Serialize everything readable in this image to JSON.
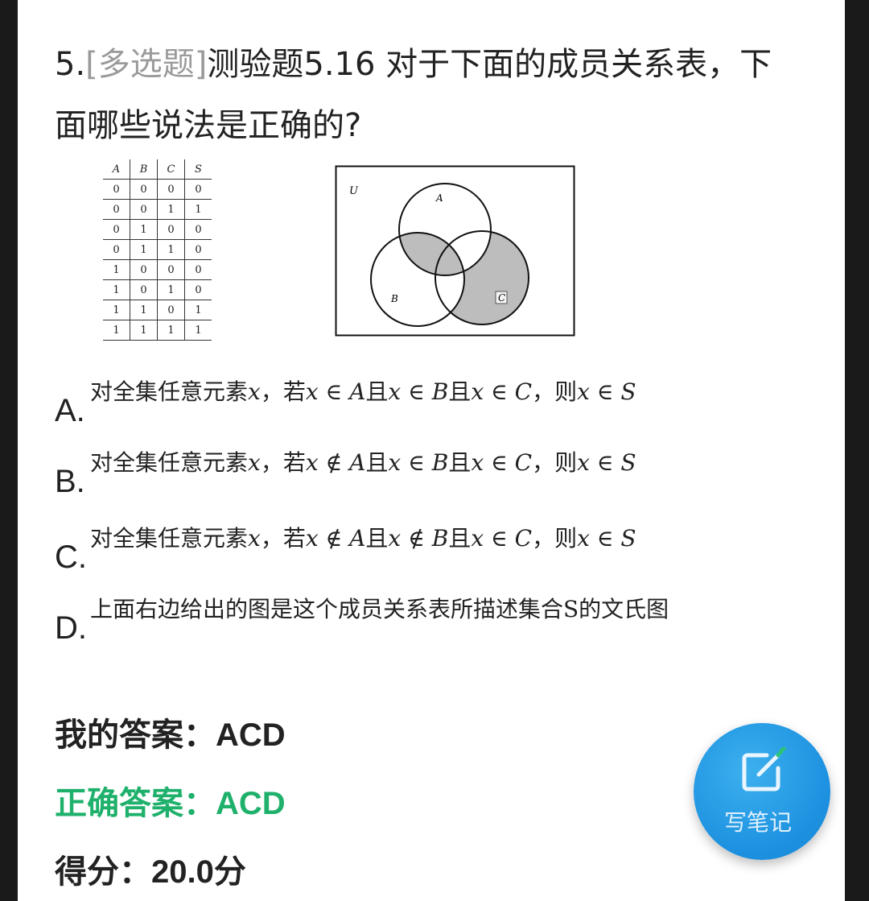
{
  "question": {
    "number": "5.",
    "type_tag": "[多选题]",
    "text": "测验题5.16 对于下面的成员关系表，下面哪些说法是正确的?"
  },
  "truth_table": {
    "headers": [
      "A",
      "B",
      "C",
      "S"
    ],
    "rows": [
      [
        "0",
        "0",
        "0",
        "0"
      ],
      [
        "0",
        "0",
        "1",
        "1"
      ],
      [
        "0",
        "1",
        "0",
        "0"
      ],
      [
        "0",
        "1",
        "1",
        "0"
      ],
      [
        "1",
        "0",
        "0",
        "0"
      ],
      [
        "1",
        "0",
        "1",
        "0"
      ],
      [
        "1",
        "1",
        "0",
        "1"
      ],
      [
        "1",
        "1",
        "1",
        "1"
      ]
    ]
  },
  "venn": {
    "universe_label": "U",
    "set_labels": [
      "A",
      "B",
      "C"
    ],
    "shade_color": "#bdbdbd"
  },
  "options": [
    {
      "letter": "A.",
      "pre": "对全集任意元素",
      "x": "x",
      "mid1": "，若",
      "cond1": "x ∈ A",
      "and1": "且",
      "cond2": "x ∈ B",
      "and2": "且",
      "cond3": "x ∈ C",
      "then": "，则",
      "concl": "x ∈ S"
    },
    {
      "letter": "B.",
      "pre": "对全集任意元素",
      "x": "x",
      "mid1": "，若",
      "cond1": "x ∉ A",
      "and1": "且",
      "cond2": "x ∈ B",
      "and2": "且",
      "cond3": "x ∈ C",
      "then": "，则",
      "concl": "x ∈ S"
    },
    {
      "letter": "C.",
      "pre": "对全集任意元素",
      "x": "x",
      "mid1": "，若",
      "cond1": "x ∉ A",
      "and1": "且",
      "cond2": "x ∉ B",
      "and2": "且",
      "cond3": "x ∈ C",
      "then": "，则",
      "concl": "x ∈ S"
    },
    {
      "letter": "D.",
      "text": "上面右边给出的图是这个成员关系表所描述集合S的文氏图"
    }
  ],
  "results": {
    "my_answer": "我的答案：ACD",
    "correct_answer": "正确答案：ACD",
    "score": "得分：20.0分"
  },
  "note_button": {
    "label": "写笔记",
    "icon": "edit-note-icon"
  },
  "colors": {
    "correct": "#1fb16c",
    "fab": "#1c90df",
    "tag": "#9a9a9a"
  }
}
